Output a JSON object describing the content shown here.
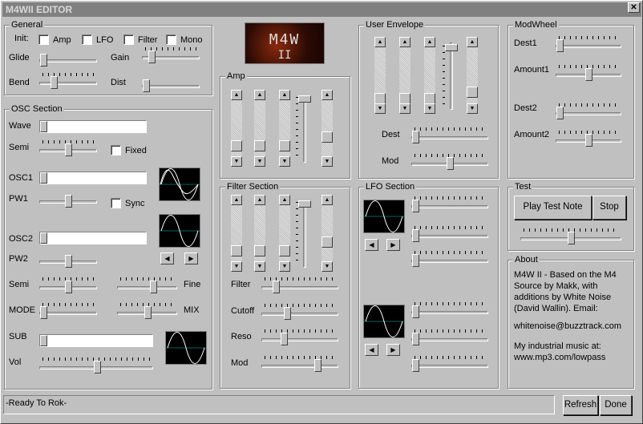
{
  "window": {
    "title": "M4WII EDITOR",
    "close_label": "✕"
  },
  "general": {
    "label": "General",
    "init_label": "Init:",
    "amp": "Amp",
    "lfo": "LFO",
    "filter": "Filter",
    "mono": "Mono",
    "glide": "Glide",
    "gain": "Gain",
    "bend": "Bend",
    "dist": "Dist"
  },
  "osc": {
    "label": "OSC Section",
    "wave": "Wave",
    "semi": "Semi",
    "fixed": "Fixed",
    "osc1": "OSC1",
    "pw1": "PW1",
    "sync": "Sync",
    "osc2": "OSC2",
    "pw2": "PW2",
    "semi2": "Semi",
    "fine": "Fine",
    "mode": "MODE",
    "mix": "MIX",
    "sub": "SUB",
    "vol": "Vol"
  },
  "amp": {
    "label": "Amp"
  },
  "filter": {
    "label": "Filter Section",
    "filter": "Filter",
    "cutoff": "Cutoff",
    "reso": "Reso",
    "mod": "Mod"
  },
  "env": {
    "label": "User Envelope",
    "dest": "Dest",
    "mod": "Mod"
  },
  "lfo": {
    "label": "LFO Section"
  },
  "modwheel": {
    "label": "ModWheel",
    "dest1": "Dest1",
    "amount1": "Amount1",
    "dest2": "Dest2",
    "amount2": "Amount2"
  },
  "test": {
    "label": "Test",
    "play": "Play Test Note",
    "stop": "Stop"
  },
  "about": {
    "label": "About",
    "text1": "M4W II - Based on the M4",
    "text2": "Source by Makk, with",
    "text3": "additions by White Noise",
    "text4": "(David Wallin). Email:",
    "email": "whitenoise@buzztrack.com",
    "music1": "My industrial music at:",
    "music2": "www.mp3.com/lowpass"
  },
  "status": {
    "text": "-Ready To Rok-",
    "refresh": "Refresh",
    "done": "Done"
  },
  "logo": {
    "text": "M4W II"
  },
  "icons": {
    "arrow_left": "◀",
    "arrow_right": "▶",
    "arrow_up": "▲",
    "arrow_down": "▼"
  }
}
